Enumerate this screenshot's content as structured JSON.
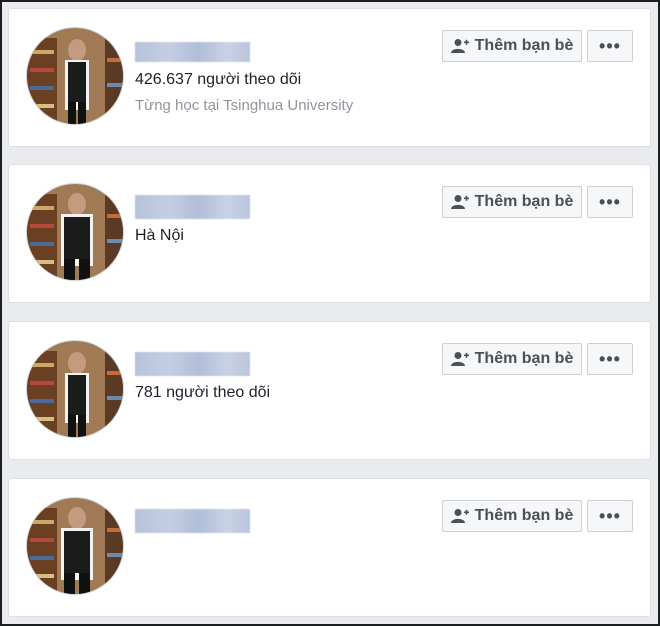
{
  "colors": {
    "page_bg": "#e9ebee",
    "card_bg": "#ffffff",
    "button_bg": "#f6f7f9",
    "button_text": "#4b4f56",
    "primary_text": "#1d2129",
    "secondary_text": "#90949c",
    "name_blur": "#b6c3db"
  },
  "cards": [
    {
      "name_redacted": true,
      "line1": "426.637 người theo dõi",
      "line2": "Từng học tại Tsinghua University",
      "add_friend_label": "Thêm bạn bè",
      "add_friend_icon": "add-friend-icon",
      "more_label": "•••",
      "more_icon": "more-dots-icon"
    },
    {
      "name_redacted": true,
      "line1": "Hà Nội",
      "line2": "",
      "add_friend_label": "Thêm bạn bè",
      "add_friend_icon": "add-friend-icon",
      "more_label": "•••",
      "more_icon": "more-dots-icon"
    },
    {
      "name_redacted": true,
      "line1": "781 người theo dõi",
      "line2": "",
      "add_friend_label": "Thêm bạn bè",
      "add_friend_icon": "add-friend-icon",
      "more_label": "•••",
      "more_icon": "more-dots-icon"
    },
    {
      "name_redacted": true,
      "line1": "",
      "line2": "",
      "add_friend_label": "Thêm bạn bè",
      "add_friend_icon": "add-friend-icon",
      "more_label": "•••",
      "more_icon": "more-dots-icon"
    }
  ]
}
